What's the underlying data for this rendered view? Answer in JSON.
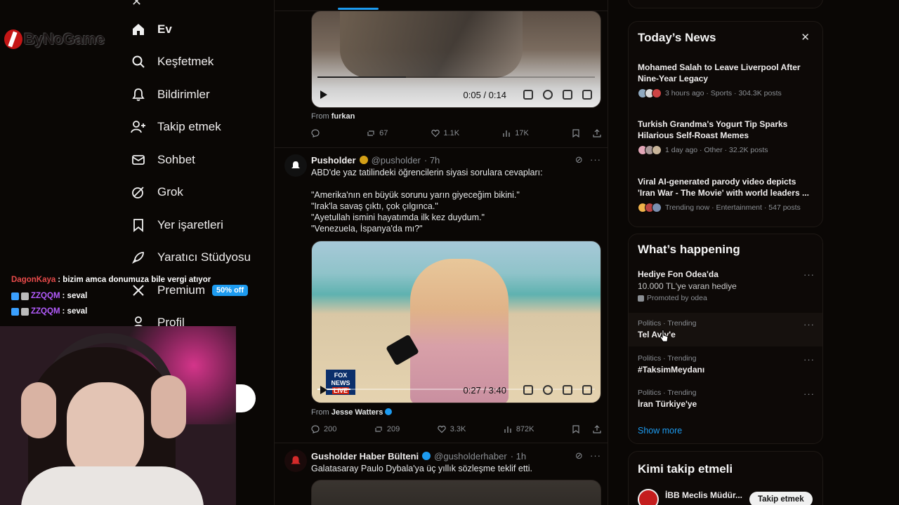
{
  "overlay": {
    "logo_text": "ByNoGame",
    "chat": [
      {
        "user": "DagonKaya",
        "message": ": bizim amca donumuza bile vergi atıyor",
        "user_color": "#e84a4a"
      },
      {
        "user": "ZZQQM",
        "message": ": seval",
        "user_color": "#b45cff"
      },
      {
        "user": "ZZQQM",
        "message": ": seval",
        "user_color": "#b45cff"
      }
    ]
  },
  "nav": {
    "items": [
      {
        "label": "Ev",
        "icon": "home-icon"
      },
      {
        "label": "Keşfetmek",
        "icon": "search-icon"
      },
      {
        "label": "Bildirimler",
        "icon": "bell-icon"
      },
      {
        "label": "Takip etmek",
        "icon": "add-user-icon"
      },
      {
        "label": "Sohbet",
        "icon": "mail-icon"
      },
      {
        "label": "Grok",
        "icon": "grok-icon"
      },
      {
        "label": "Yer işaretleri",
        "icon": "bookmark-icon"
      },
      {
        "label": "Yaratıcı Stüdyosu",
        "icon": "rocket-icon"
      },
      {
        "label": "Premium",
        "icon": "x-logo-icon"
      },
      {
        "label": "Profil",
        "icon": "person-icon"
      }
    ],
    "premium_badge": "50% off"
  },
  "feed": {
    "post1": {
      "video_time": "0:05 / 0:14",
      "from_prefix": "From",
      "from_user": "furkan",
      "replies": "",
      "reposts": "67",
      "likes": "1.1K",
      "views": "17K"
    },
    "post2": {
      "name": "Pusholder",
      "handle": "@pusholder",
      "time": "· 7h",
      "text": "ABD'de yaz tatilindeki öğrencilerin siyasi sorulara cevapları:\n\n\"Amerika'nın en büyük sorunu yarın giyeceğim bikini.\"\n\"Irak'la savaş çıktı, çok çılgınca.\"\n\"Ayetullah ismini hayatımda ilk kez duydum.\"\n\"Venezuela, İspanya'da mı?\"",
      "video_time": "0:27 / 3:40",
      "from_prefix": "From",
      "from_user": "Jesse Watters",
      "replies": "200",
      "reposts": "209",
      "likes": "3.3K",
      "views": "872K"
    },
    "post3": {
      "name": "Gusholder Haber Bülteni",
      "handle": "@gusholderhaber",
      "time": "· 1h",
      "text": "Galatasaray Paulo Dybala'ya üç yıllık sözleşme teklif etti."
    }
  },
  "news": {
    "title": "Today’s News",
    "items": [
      {
        "title": "Mohamed Salah to Leave Liverpool After Nine-Year Legacy",
        "meta": "3 hours ago · Sports · 304.3K posts"
      },
      {
        "title": "Turkish Grandma's Yogurt Tip Sparks Hilarious Self-Roast Memes",
        "meta": "1 day ago · Other · 32.2K posts"
      },
      {
        "title": "Viral AI-generated parody video depicts 'Iran War - The Movie' with world leaders ...",
        "meta": "Trending now · Entertainment · 547 posts"
      }
    ]
  },
  "happening": {
    "title": "What’s happening",
    "promo": {
      "name": "Hediye Fon Odea'da",
      "desc": "10.000 TL'ye varan hediye",
      "promoted": "Promoted by odea"
    },
    "trends": [
      {
        "category": "Politics · Trending",
        "name": "Tel Aviv'e"
      },
      {
        "category": "Politics · Trending",
        "name": "#TaksimMeydanı"
      },
      {
        "category": "Politics · Trending",
        "name": "İran Türkiye'ye"
      }
    ],
    "show_more": "Show more"
  },
  "who_to_follow": {
    "title": "Kimi takip etmeli",
    "account_name": "İBB Meclis Müdür...",
    "follow_label": "Takip etmek"
  },
  "colors": {
    "accent": "#1d9bf0",
    "background": "#0a0705"
  }
}
